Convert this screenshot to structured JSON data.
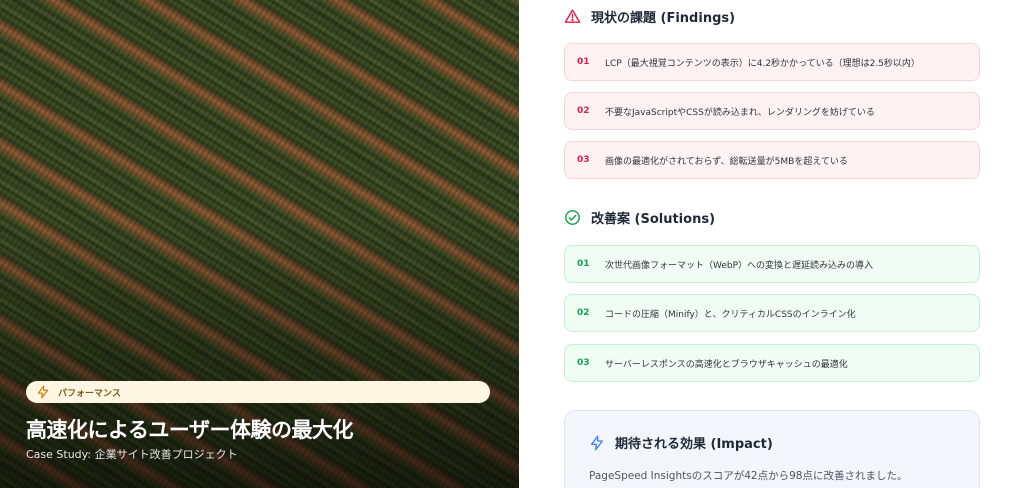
{
  "hero": {
    "badge_label": "パフォーマンス",
    "title": "高速化によるユーザー体験の最大化",
    "subtitle": "Case Study: 企業サイト改善プロジェクト"
  },
  "findings": {
    "title": "現状の課題 (Findings)",
    "icon": "warning-triangle-icon",
    "items": [
      {
        "num": "01",
        "text": "LCP（最大視覚コンテンツの表示）に4.2秒かかっている（理想は2.5秒以内）"
      },
      {
        "num": "02",
        "text": "不要なJavaScriptやCSSが読み込まれ、レンダリングを妨げている"
      },
      {
        "num": "03",
        "text": "画像の最適化がされておらず、総転送量が5MBを超えている"
      }
    ]
  },
  "solutions": {
    "title": "改善案 (Solutions)",
    "icon": "check-circle-icon",
    "items": [
      {
        "num": "01",
        "text": "次世代画像フォーマット（WebP）への変換と遅延読み込みの導入"
      },
      {
        "num": "02",
        "text": "コードの圧縮（Minify）と、クリティカルCSSのインライン化"
      },
      {
        "num": "03",
        "text": "サーバーレスポンスの高速化とブラウザキャッシュの最適化"
      }
    ]
  },
  "impact": {
    "title": "期待される効果 (Impact)",
    "icon": "lightning-icon",
    "text": "PageSpeed Insightsのスコアが42点から98点に改善されました。"
  },
  "colors": {
    "findings_accent": "#e11d48",
    "solutions_accent": "#16a34a",
    "impact_accent": "#3b82f6",
    "badge_accent": "#d97706"
  }
}
